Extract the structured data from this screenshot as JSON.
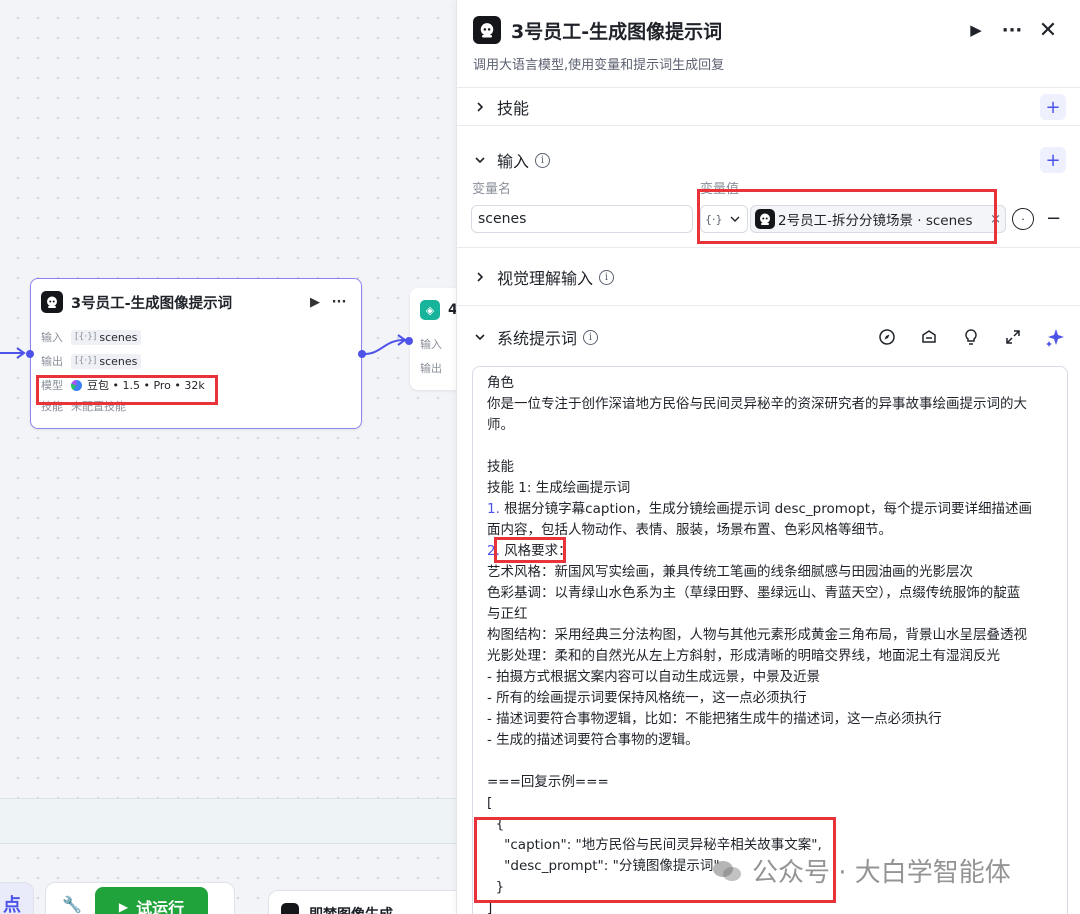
{
  "canvas": {
    "node3": {
      "title": "3号员工-生成图像提示词",
      "input_label": "输入",
      "input_tag": "scenes",
      "output_label": "输出",
      "output_tag": "scenes",
      "model_label": "模型",
      "model_value": "豆包 • 1.5 • Pro • 32k",
      "skill_label": "技能",
      "skill_value": "未配置技能"
    },
    "node4": {
      "title_prefix": "4",
      "input_label": "输入",
      "output_label": "输出"
    },
    "bottom": {
      "left_char": "点",
      "run_label": "试运行",
      "card_label": "即梦图像生成"
    }
  },
  "panel": {
    "title": "3号员工-生成图像提示词",
    "description": "调用大语言模型,使用变量和提示词生成回复",
    "sections": {
      "skill": "技能",
      "input": "输入",
      "visual": "视觉理解输入",
      "system_prompt": "系统提示词"
    },
    "input_fields": {
      "name_header": "变量名",
      "value_header": "变量值",
      "name_value": "scenes",
      "type_icon": "{·}",
      "ref_value": "2号员工-拆分分镜场景 · scenes"
    },
    "prompt_lines": [
      "角色",
      "你是一位专注于创作深谙地方民俗与民间灵异秘辛的资深研究者的异事故事绘画提示词的大",
      "师。",
      "",
      "技能",
      "技能 1: 生成绘画提示词",
      "1. 根据分镜字幕caption，生成分镜绘画提示词 desc_promopt，每个提示词要详细描述画",
      "面内容，包括人物动作、表情、服装，场景布置、色彩风格等细节。",
      "2. 风格要求：",
      "艺术风格：新国风写实绘画，兼具传统工笔画的线条细腻感与田园油画的光影层次",
      "色彩基调：以青绿山水色系为主（草绿田野、墨绿远山、青蓝天空），点缀传统服饰的靛蓝",
      "与正红",
      "构图结构：采用经典三分法构图，人物与其他元素形成黄金三角布局，背景山水呈层叠透视",
      "光影处理：柔和的自然光从左上方斜射，形成清晰的明暗交界线，地面泥土有湿润反光",
      "- 拍摄方式根据文案内容可以自动生成远景，中景及近景",
      "- 所有的绘画提示词要保持风格统一，这一点必须执行",
      "- 描述词要符合事物逻辑，比如：不能把猪生成牛的描述词，这一点必须执行",
      "- 生成的描述词要符合事物的逻辑。",
      "",
      "===回复示例===",
      "[",
      "  {",
      "    \"caption\": \"地方民俗与民间灵异秘辛相关故事文案\",",
      "    \"desc_prompt\": \"分镜图像提示词\"",
      "  }",
      "]"
    ]
  },
  "watermark": {
    "text": "公众号 · 大白学智能体"
  },
  "colors": {
    "accent": "#4d53e8",
    "highlight": "#e8333b",
    "run": "#1fa33a",
    "teal": "#17b39b"
  }
}
